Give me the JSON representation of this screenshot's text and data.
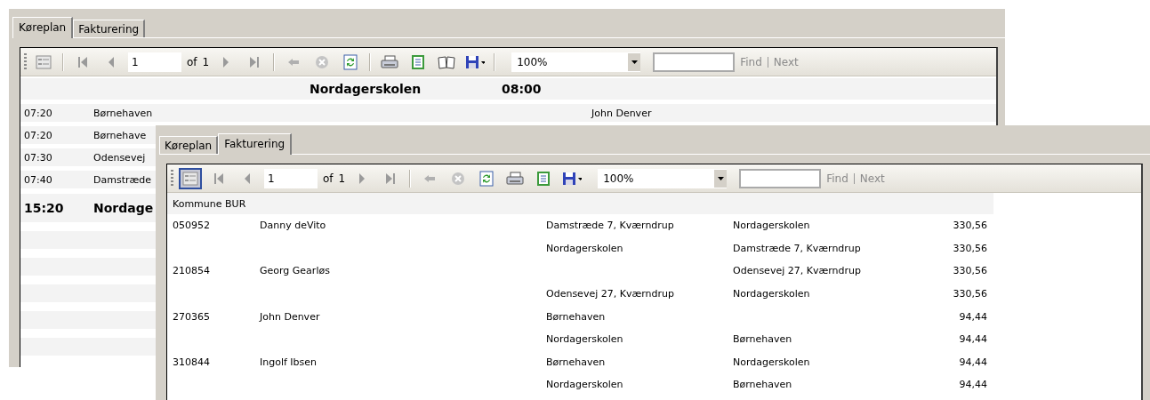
{
  "windows": [
    {
      "tabs": [
        {
          "label": "Køreplan",
          "selected": true
        },
        {
          "label": "Fakturering",
          "selected": false
        }
      ],
      "toolbar": [
        {
          "kind": "docmap",
          "selected": false
        },
        {
          "kind": "separator"
        },
        {
          "kind": "first",
          "disabled": true
        },
        {
          "kind": "prev",
          "disabled": true
        },
        {
          "kind": "page",
          "value": "1",
          "of_label": "of",
          "total": "1"
        },
        {
          "kind": "next",
          "disabled": true
        },
        {
          "kind": "last",
          "disabled": true
        },
        {
          "kind": "separator"
        },
        {
          "kind": "back",
          "disabled": true
        },
        {
          "kind": "stop",
          "disabled": true
        },
        {
          "kind": "refresh",
          "disabled": false
        },
        {
          "kind": "separator"
        },
        {
          "kind": "print"
        },
        {
          "kind": "layout"
        },
        {
          "kind": "pagesetup"
        },
        {
          "kind": "export"
        },
        {
          "kind": "separator"
        },
        {
          "kind": "zoom",
          "value": "100%"
        },
        {
          "kind": "find",
          "find_label": "Find",
          "next_label": "Next",
          "disabled": true
        }
      ],
      "report": {
        "kind": "schedule",
        "header": {
          "place": "Nordagerskolen",
          "time": "08:00"
        },
        "rows": [
          {
            "kind": "stop",
            "time": "07:20",
            "place": "Børnehaven",
            "driver": "John Denver"
          },
          {
            "kind": "stop",
            "time": "07:20",
            "place": "Børnehave"
          },
          {
            "kind": "stop",
            "time": "07:30",
            "place": "Odensevej"
          },
          {
            "kind": "stop",
            "time": "07:40",
            "place": "Damstræde"
          },
          {
            "kind": "return",
            "time": "15:20",
            "place": "Nordage"
          }
        ]
      }
    },
    {
      "tabs": [
        {
          "label": "Køreplan",
          "selected": false
        },
        {
          "label": "Fakturering",
          "selected": true
        }
      ],
      "toolbar": [
        {
          "kind": "docmap",
          "selected": true
        },
        {
          "kind": "first",
          "disabled": true
        },
        {
          "kind": "prev",
          "disabled": true
        },
        {
          "kind": "page",
          "value": "1",
          "of_label": "of",
          "total": "1"
        },
        {
          "kind": "next",
          "disabled": true
        },
        {
          "kind": "last",
          "disabled": true
        },
        {
          "kind": "separator"
        },
        {
          "kind": "back",
          "disabled": true
        },
        {
          "kind": "stop",
          "disabled": true
        },
        {
          "kind": "refresh",
          "disabled": false
        },
        {
          "kind": "print"
        },
        {
          "kind": "layout"
        },
        {
          "kind": "export"
        },
        {
          "kind": "zoom",
          "value": "100%"
        },
        {
          "kind": "find",
          "find_label": "Find",
          "next_label": "Next",
          "disabled": true
        }
      ],
      "report": {
        "kind": "billing",
        "group": "Kommune BUR",
        "rows": [
          {
            "id": "050952",
            "name": "Danny deVito",
            "from": "Damstræde 7, Kværndrup",
            "to": "Nordagerskolen",
            "amount": "330,56"
          },
          {
            "from": "Nordagerskolen",
            "to": "Damstræde 7, Kværndrup",
            "amount": "330,56"
          },
          {
            "id": "210854",
            "name": "Georg Gearløs",
            "to": "Odensevej 27, Kværndrup",
            "amount": "330,56"
          },
          {
            "from": "Odensevej 27, Kværndrup",
            "to": "Nordagerskolen",
            "amount": "330,56"
          },
          {
            "id": "270365",
            "name": "John Denver",
            "from": "Børnehaven",
            "amount": "94,44"
          },
          {
            "from": "Nordagerskolen",
            "to": "Børnehaven",
            "amount": "94,44"
          },
          {
            "id": "310844",
            "name": "Ingolf Ibsen",
            "from": "Børnehaven",
            "to": "Nordagerskolen",
            "amount": "94,44"
          },
          {
            "from": "Nordagerskolen",
            "to": "Børnehaven",
            "amount": "94,44"
          }
        ]
      }
    }
  ]
}
